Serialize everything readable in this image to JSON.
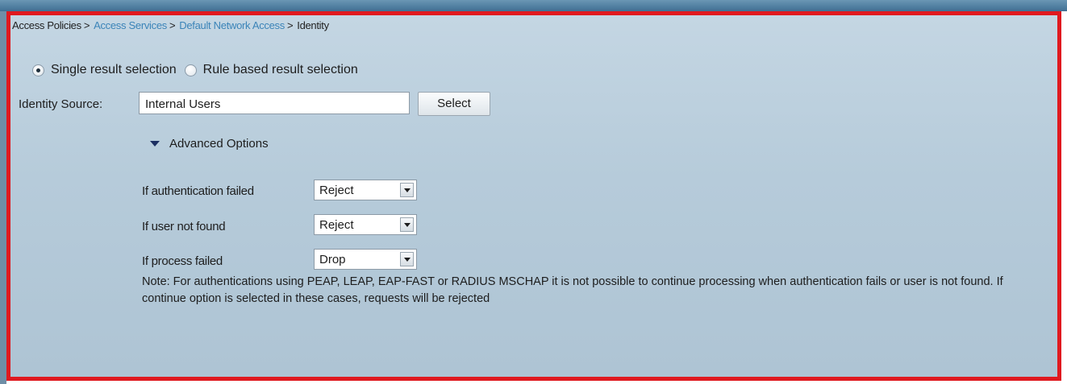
{
  "breadcrumb": {
    "items": [
      {
        "label": "Access Policies",
        "link": false
      },
      {
        "label": "Access Services",
        "link": true
      },
      {
        "label": "Default Network Access",
        "link": true
      },
      {
        "label": "Identity",
        "link": false
      }
    ],
    "separator": ">"
  },
  "result_selection": {
    "single_label": "Single result selection",
    "single_checked": true,
    "rule_label": "Rule based result selection",
    "rule_checked": false
  },
  "identity_source": {
    "label": "Identity Source:",
    "value": "Internal Users",
    "select_button": "Select"
  },
  "advanced_options": {
    "label": "Advanced Options",
    "expanded": true,
    "options": [
      {
        "label": "If authentication failed",
        "value": "Reject"
      },
      {
        "label": "If user not found",
        "value": "Reject"
      },
      {
        "label": "If process failed",
        "value": "Drop"
      }
    ],
    "note": "Note: For authentications using PEAP, LEAP, EAP-FAST or RADIUS MSCHAP it is not possible to continue processing when authentication fails or user is not found. If continue option is selected in these cases, requests will be rejected"
  },
  "colors": {
    "frame_border": "#e0191f",
    "link": "#3b84b8",
    "panel_background": "#b6cbda"
  }
}
